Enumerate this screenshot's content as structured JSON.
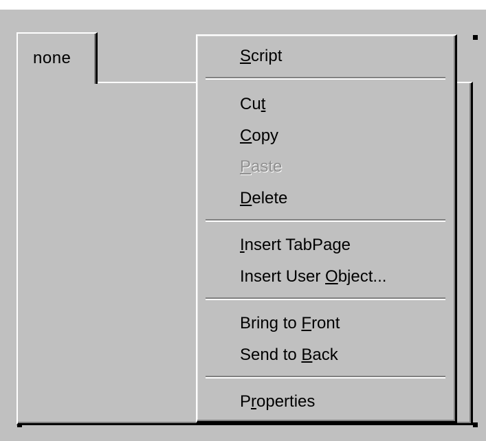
{
  "tab_control": {
    "tab_label": "none"
  },
  "context_menu": {
    "items": [
      {
        "label": "Script",
        "mnemonic_index": 0,
        "enabled": true
      },
      {
        "label": "Cut",
        "mnemonic_index": 2,
        "enabled": true
      },
      {
        "label": "Copy",
        "mnemonic_index": 0,
        "enabled": true
      },
      {
        "label": "Paste",
        "mnemonic_index": 0,
        "enabled": false
      },
      {
        "label": "Delete",
        "mnemonic_index": 0,
        "enabled": true
      },
      {
        "label": "Insert TabPage",
        "mnemonic_index": 0,
        "enabled": true
      },
      {
        "label": "Insert User Object...",
        "mnemonic_index": 12,
        "enabled": true
      },
      {
        "label": "Bring to Front",
        "mnemonic_index": 9,
        "enabled": true
      },
      {
        "label": "Send to Back",
        "mnemonic_index": 8,
        "enabled": true
      },
      {
        "label": "Properties",
        "mnemonic_index": 1,
        "enabled": true
      }
    ]
  },
  "colors": {
    "face": "#c0c0c0",
    "highlight": "#ffffff",
    "shadow": "#808080",
    "dark_shadow": "#000000",
    "disabled_text": "#8f8f8f"
  }
}
